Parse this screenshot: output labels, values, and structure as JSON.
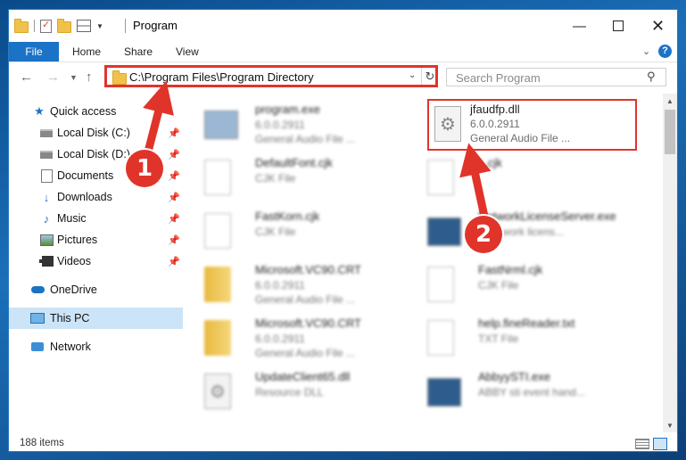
{
  "window": {
    "title": "Program"
  },
  "ribbon": {
    "tabs": [
      "File",
      "Home",
      "Share",
      "View"
    ]
  },
  "address": {
    "path": "C:\\Program Files\\Program Directory"
  },
  "search": {
    "placeholder": "Search Program"
  },
  "nav": {
    "items": [
      {
        "label": "Quick access",
        "icon": "star-icon",
        "pinned": false
      },
      {
        "label": "Local Disk (C:)",
        "icon": "drive-icon",
        "pinned": true
      },
      {
        "label": "Local Disk (D:)",
        "icon": "drive-icon",
        "pinned": true
      },
      {
        "label": "Documents",
        "icon": "documents-icon",
        "pinned": true
      },
      {
        "label": "Downloads",
        "icon": "download-icon",
        "pinned": true
      },
      {
        "label": "Music",
        "icon": "music-icon",
        "pinned": true
      },
      {
        "label": "Pictures",
        "icon": "pictures-icon",
        "pinned": true
      },
      {
        "label": "Videos",
        "icon": "videos-icon",
        "pinned": true
      },
      {
        "label": "OneDrive",
        "icon": "cloud-icon",
        "pinned": false
      },
      {
        "label": "This PC",
        "icon": "computer-icon",
        "pinned": false,
        "selected": true
      },
      {
        "label": "Network",
        "icon": "network-icon",
        "pinned": false
      }
    ]
  },
  "files": [
    {
      "name": "program.exe",
      "line1": "6.0.0.2911",
      "line2": "General Audio File ...",
      "icon": "exe-icon"
    },
    {
      "name": "jfaudfp.dll",
      "line1": "6.0.0.2911",
      "line2": "General Audio File ...",
      "icon": "dll-gear-icon",
      "highlighted": true
    },
    {
      "name": "DefaultFont.cjk",
      "line1": "CJK File",
      "line2": "",
      "icon": "document-icon"
    },
    {
      "name": "...cjk",
      "line1": "",
      "line2": "",
      "icon": "document-icon"
    },
    {
      "name": "FastKorn.cjk",
      "line1": "CJK File",
      "line2": "",
      "icon": "document-icon"
    },
    {
      "name": "NetworkLicenseServer.exe",
      "line1": "...network licens...",
      "line2": "",
      "icon": "exe-icon"
    },
    {
      "name": "Microsoft.VC90.CRT",
      "line1": "6.0.0.2911",
      "line2": "General Audio File ...",
      "icon": "folder-icon"
    },
    {
      "name": "FastNrml.cjk",
      "line1": "CJK File",
      "line2": "",
      "icon": "document-icon"
    },
    {
      "name": "Microsoft.VC90.CRT",
      "line1": "6.0.0.2911",
      "line2": "General Audio File ...",
      "icon": "folder-icon"
    },
    {
      "name": "help.fineReader.txt",
      "line1": "TXT File",
      "line2": "",
      "icon": "document-icon"
    },
    {
      "name": "UpdateClient65.dll",
      "line1": "Resource DLL",
      "line2": "",
      "icon": "dll-gear-icon"
    },
    {
      "name": "AbbyySTI.exe",
      "line1": "ABBY sti event hand...",
      "line2": "",
      "icon": "exe-icon"
    }
  ],
  "status": {
    "item_count": "188 items"
  },
  "annotations": {
    "badge1": "1",
    "badge2": "2"
  },
  "colors": {
    "accent": "#1a73c6",
    "highlight": "#e0342b",
    "selected_nav": "#cce4f7"
  }
}
